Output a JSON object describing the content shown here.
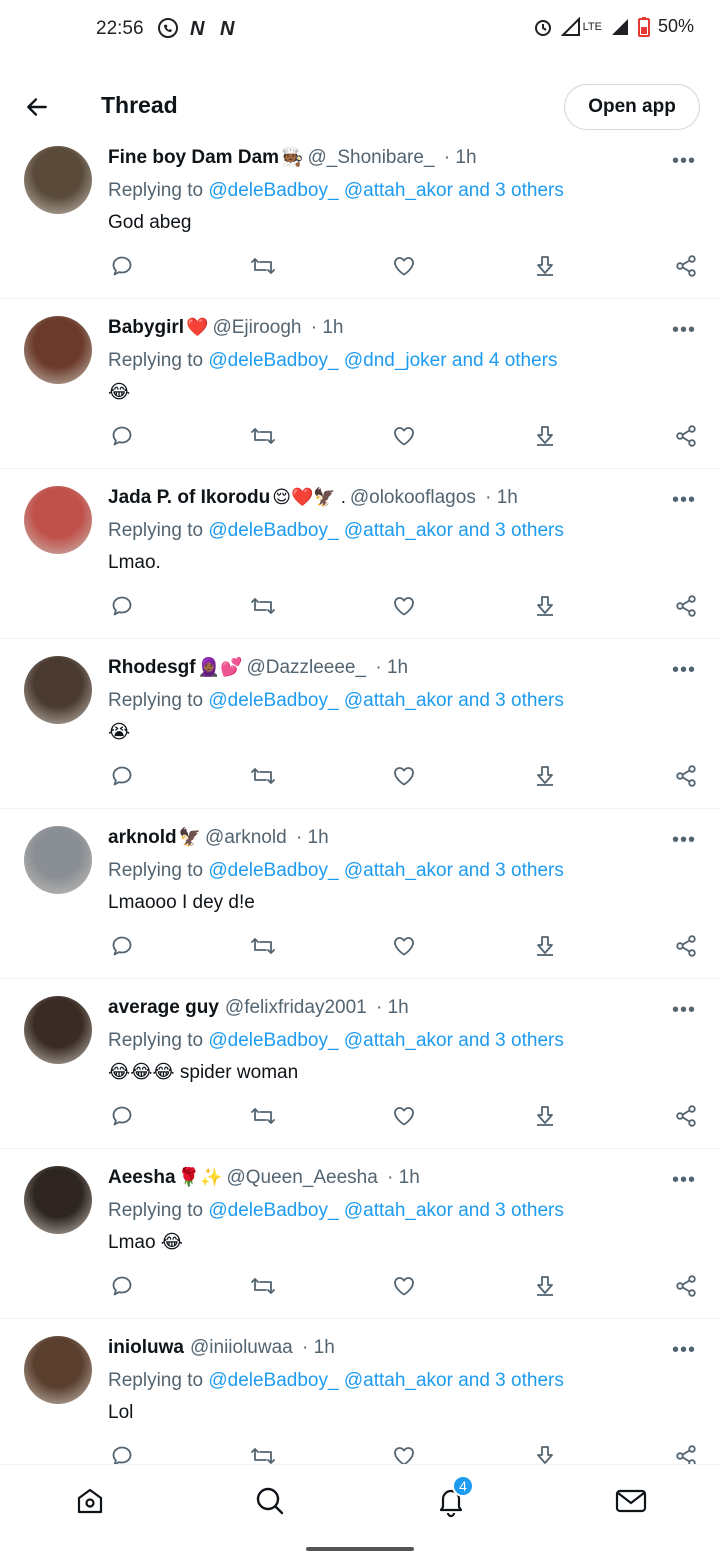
{
  "status_bar": {
    "time": "22:56",
    "battery": "50%",
    "network": "LTE"
  },
  "header": {
    "title": "Thread",
    "open_app_label": "Open app"
  },
  "replying_to_label": "Replying to",
  "tweets": [
    {
      "name": "Fine boy Dam Dam",
      "name_emoji": "🧑🏾‍🍳",
      "handle": "@_Shonibare_",
      "time": "· 1h",
      "mention1": "@deleBadboy_",
      "mention2": "@attah_akor",
      "others": "and 3 others",
      "text": "God abeg",
      "avatar_color": "#5a4a3a"
    },
    {
      "name": "Babygirl",
      "name_emoji": "❤️",
      "handle": "@Ejiroogh",
      "time": "· 1h",
      "mention1": "@deleBadboy_",
      "mention2": "@dnd_joker",
      "others": "and 4 others",
      "text": "😂",
      "avatar_color": "#6b3a2a"
    },
    {
      "name": "Jada P. of Ikorodu",
      "name_emoji": "😌❤️🦅 .",
      "handle": "@olokooflagos",
      "time": "· 1h",
      "mention1": "@deleBadboy_",
      "mention2": "@attah_akor",
      "others": "and 3 others",
      "text": "Lmao.",
      "avatar_color": "#c0504a"
    },
    {
      "name": "Rhodesgf",
      "name_emoji": "🧕🏾💕",
      "handle": "@Dazzleeee_",
      "time": "· 1h",
      "mention1": "@deleBadboy_",
      "mention2": "@attah_akor",
      "others": "and 3 others",
      "text": "😭",
      "avatar_color": "#4a3a30"
    },
    {
      "name": "arknold",
      "name_emoji": "🦅",
      "handle": "@arknold",
      "time": "· 1h",
      "mention1": "@deleBadboy_",
      "mention2": "@attah_akor",
      "others": "and 3 others",
      "text": "Lmaooo I dey d!e",
      "avatar_color": "#8a8f95"
    },
    {
      "name": "average guy",
      "name_emoji": "",
      "handle": "@felixfriday2001",
      "time": "· 1h",
      "mention1": "@deleBadboy_",
      "mention2": "@attah_akor",
      "others": "and 3 others",
      "text": "😂😂😂 spider woman",
      "avatar_color": "#3a2c24"
    },
    {
      "name": "Aeesha",
      "name_emoji": "🌹✨",
      "handle": "@Queen_Aeesha",
      "time": "· 1h",
      "mention1": "@deleBadboy_",
      "mention2": "@attah_akor",
      "others": "and 3 others",
      "text": "Lmao 😂",
      "avatar_color": "#2e2520"
    },
    {
      "name": "inioluwa",
      "name_emoji": "",
      "handle": "@iniioluwaa",
      "time": "· 1h",
      "mention1": "@deleBadboy_",
      "mention2": "@attah_akor",
      "others": "and 3 others",
      "text": "Lol",
      "avatar_color": "#5b3f2e"
    }
  ],
  "bottom_nav": {
    "notifications_badge": "4"
  },
  "colors": {
    "accent": "#1d9bf0",
    "text": "#0f1419",
    "secondary": "#536471"
  }
}
